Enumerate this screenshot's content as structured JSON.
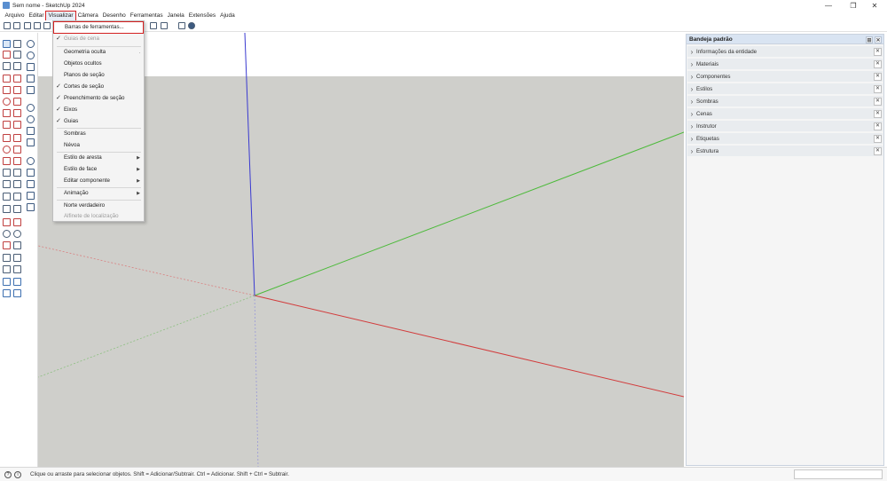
{
  "window": {
    "title": "Sem nome - SketchUp 2024",
    "controls": [
      "—",
      "❐",
      "✕"
    ]
  },
  "menubar": {
    "items": [
      "Arquivo",
      "Editar",
      "Visualizar",
      "Câmera",
      "Desenho",
      "Ferramentas",
      "Janela",
      "Extensões",
      "Ajuda"
    ],
    "active": "Visualizar"
  },
  "view_menu": {
    "items": [
      {
        "label": "Barras de ferramentas...",
        "checked": false,
        "submenu": false,
        "disabled": false,
        "highlighted": true
      },
      {
        "label": "Guias de cena",
        "checked": true,
        "submenu": false,
        "disabled": true
      },
      {
        "label": "Geometria oculta",
        "checked": false,
        "submenu": false,
        "disabled": false,
        "suffix": "."
      },
      {
        "label": "Objetos ocultos",
        "checked": false,
        "submenu": false,
        "disabled": false
      },
      {
        "label": "Planos de seção",
        "checked": false,
        "submenu": false,
        "disabled": false
      },
      {
        "label": "Cortes de seção",
        "checked": true,
        "submenu": false,
        "disabled": false
      },
      {
        "label": "Preenchimento de seção",
        "checked": true,
        "submenu": false,
        "disabled": false
      },
      {
        "label": "Eixos",
        "checked": true,
        "submenu": false,
        "disabled": false
      },
      {
        "label": "Guias",
        "checked": true,
        "submenu": false,
        "disabled": false
      },
      {
        "label": "Sombras",
        "checked": false,
        "submenu": false,
        "disabled": false
      },
      {
        "label": "Névoa",
        "checked": false,
        "submenu": false,
        "disabled": false
      },
      {
        "label": "Estilo de aresta",
        "checked": false,
        "submenu": true,
        "disabled": false
      },
      {
        "label": "Estilo de face",
        "checked": false,
        "submenu": true,
        "disabled": false
      },
      {
        "label": "Editar componente",
        "checked": false,
        "submenu": true,
        "disabled": false
      },
      {
        "label": "Animação",
        "checked": false,
        "submenu": true,
        "disabled": false
      },
      {
        "label": "Norte verdadeiro",
        "checked": false,
        "submenu": false,
        "disabled": false
      },
      {
        "label": "Alfinete de localização",
        "checked": false,
        "submenu": false,
        "disabled": true
      }
    ]
  },
  "tray": {
    "title": "Bandeja padrão",
    "panels": [
      "Informações da entidade",
      "Materiais",
      "Componentes",
      "Estilos",
      "Sombras",
      "Cenas",
      "Instrutor",
      "Etiquetas",
      "Estrutura"
    ]
  },
  "status": {
    "text": "Clique ou arraste para selecionar objetos. Shift = Adicionar/Subtrair. Ctrl = Adicionar. Shift + Ctrl = Subtrair."
  },
  "colors": {
    "sky": "#ffffff",
    "ground": "#cfcfcb",
    "axis_red": "#d23b3b",
    "axis_green": "#4cba3a",
    "axis_blue": "#3a3ad0",
    "menu_highlight": "#d42020",
    "tray_header": "#d9e4f2"
  }
}
